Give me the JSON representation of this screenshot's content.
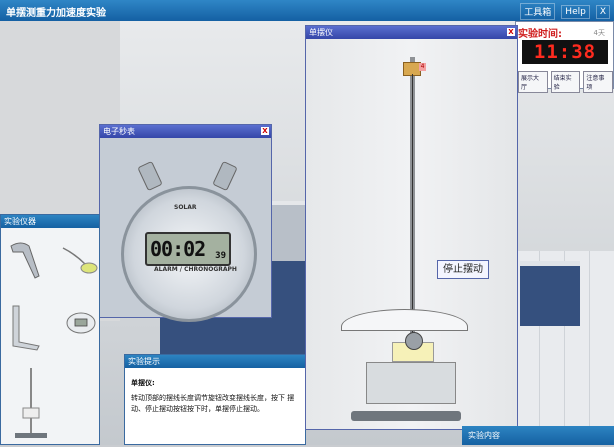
{
  "app": {
    "title": "单摆测重力加速度实验",
    "toolbar": {
      "tools_label": "工具箱",
      "help_label": "Help",
      "close_label": "X"
    }
  },
  "timer_panel": {
    "label": "实验时间:",
    "days_label": "4天",
    "display": "11:38",
    "buttons": [
      "展示大厅",
      "结束实验",
      "注意事项"
    ]
  },
  "stopwatch": {
    "title": "电子秒表",
    "close_label": "X",
    "solar_text": "SOLAR",
    "brand_text": "ALARM / CHRONOGRAPH",
    "main_digits": "00:02",
    "small_digits": "39"
  },
  "instruments": {
    "title": "实验仪器"
  },
  "hint": {
    "title": "实验提示",
    "heading": "单摆仪:",
    "body": "转动顶部的摆线长度调节旋钮改变摆线长度，按下 摆动、停止摆动按钮按下时，单摆停止摆动。"
  },
  "pendulum": {
    "title": "单摆仪",
    "close_label": "X",
    "clamp_tag": "4",
    "stop_button": "停止摆动"
  },
  "content_tab": {
    "label": "实验内容"
  }
}
